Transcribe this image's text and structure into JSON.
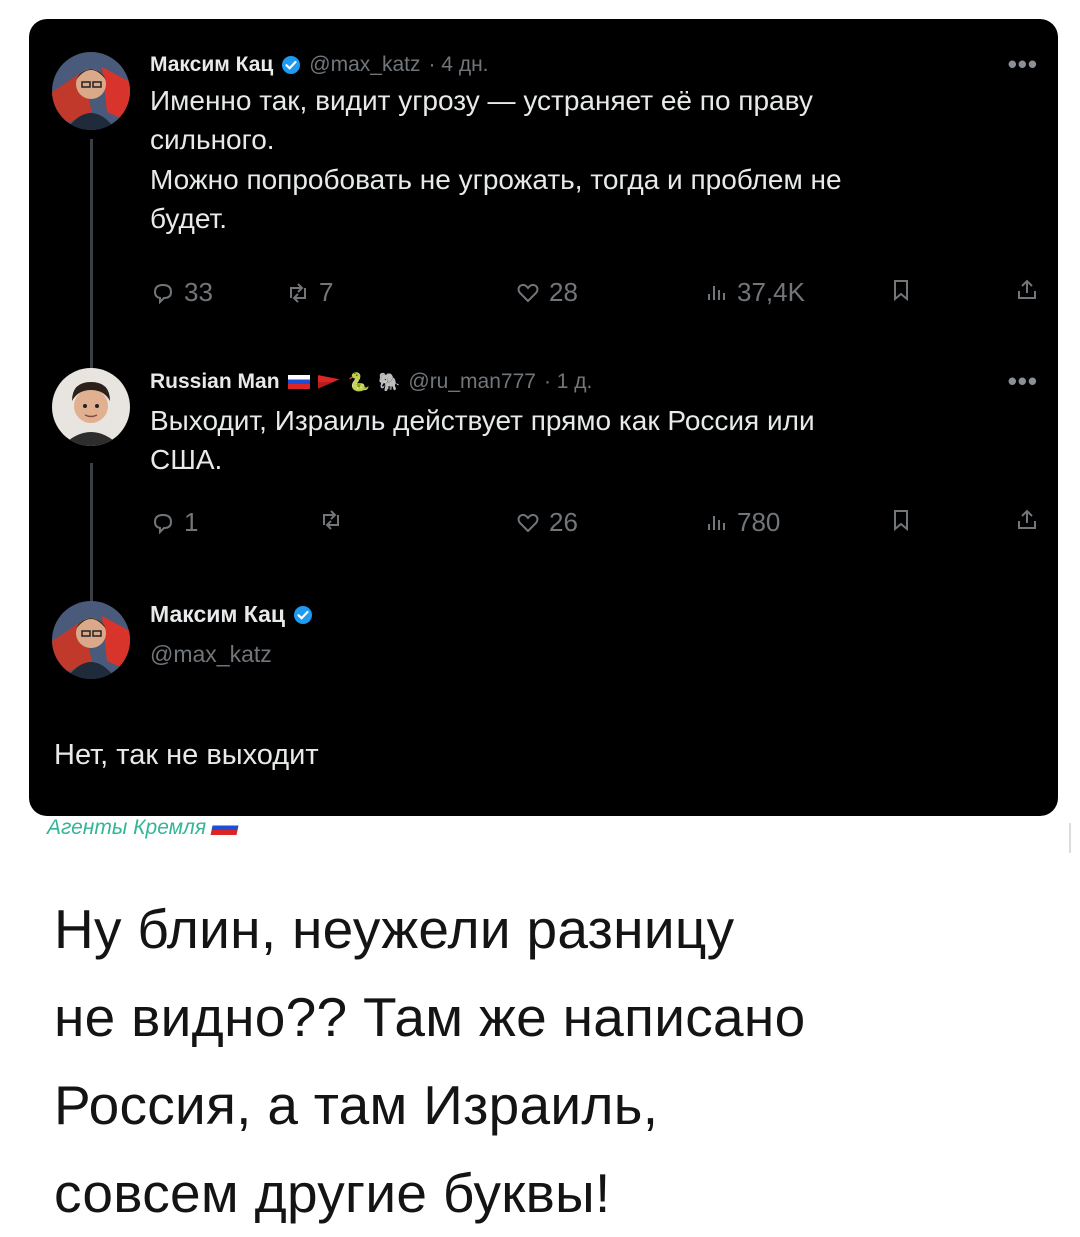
{
  "tweets": [
    {
      "name": "Максим Кац",
      "handle": "@max_katz",
      "time": "· 4 дн.",
      "more": "•••",
      "lines": [
        "Именно так, видит угрозу — устраняет её по праву",
        "сильного.",
        "Можно попробовать не угрожать, тогда и проблем не",
        "будет."
      ],
      "replies": "33",
      "retweets": "7",
      "likes": "28",
      "views": "37,4K"
    },
    {
      "name": "Russian Man",
      "handle": "@ru_man777",
      "time": "· 1 д.",
      "more": "•••",
      "lines": [
        "Выходит, Израиль действует прямо как Россия или",
        "США."
      ],
      "replies": "1",
      "retweets": "",
      "likes": "26",
      "views": "780"
    },
    {
      "name": "Максим Кац",
      "handle": "@max_katz",
      "text": "Нет, так не выходит"
    }
  ],
  "icons": {
    "verified_color": "#1d9bf0",
    "reply": "reply-icon",
    "retweet": "retweet-icon",
    "like": "heart-icon",
    "views": "views-icon",
    "bookmark": "bookmark-icon",
    "share": "share-icon"
  },
  "watermark": {
    "text": "Агенты Кремля",
    "color": "#35b597"
  },
  "caption": {
    "lines": [
      "Ну блин, неужели разницу",
      "не видно?? Там же написано",
      "Россия, а там Израиль,",
      "совсем другие буквы!"
    ]
  }
}
